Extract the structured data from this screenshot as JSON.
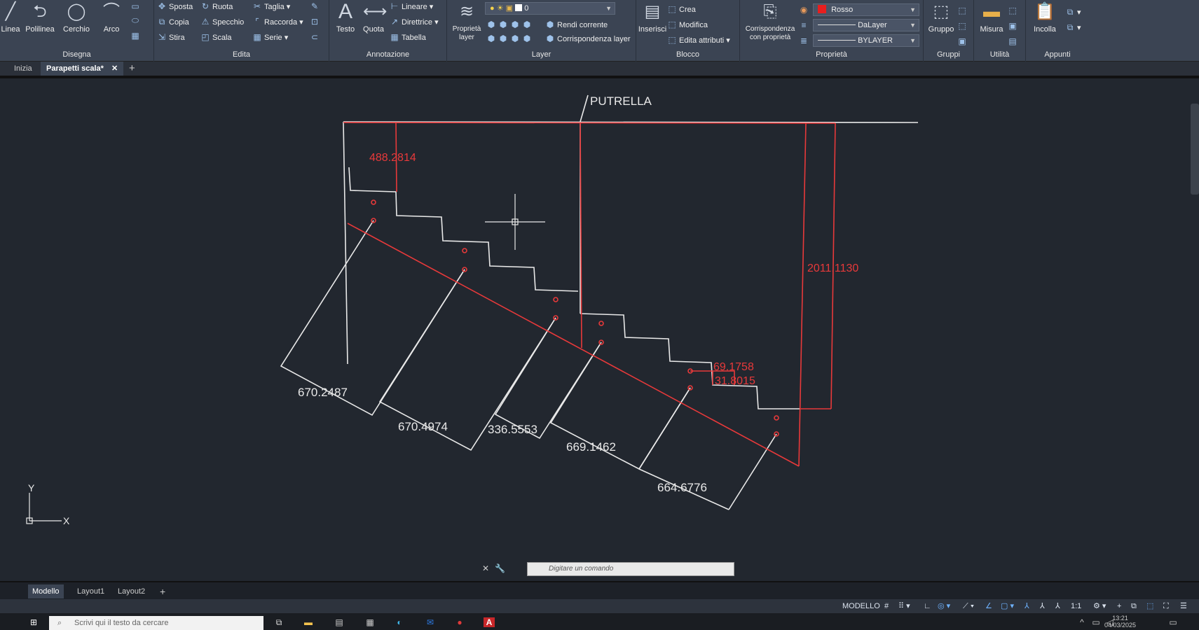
{
  "ribbon": {
    "disegna": {
      "title": "Disegna",
      "tools": [
        "Linea",
        "Polilinea",
        "Cerchio",
        "Arco"
      ]
    },
    "edita": {
      "title": "Edita",
      "tools": [
        "Sposta",
        "Ruota",
        "Taglia",
        "Copia",
        "Specchio",
        "Raccorda",
        "Stira",
        "Scala",
        "Serie"
      ]
    },
    "annotazione": {
      "title": "Annotazione",
      "tools": [
        "Testo",
        "Quota",
        "Lineare",
        "Direttrice",
        "Tabella"
      ]
    },
    "layer": {
      "title": "Layer",
      "proprieta_label": "Proprietà layer",
      "current_layer": "0",
      "tools": [
        "Rendi corrente",
        "Corrispondenza layer"
      ]
    },
    "blocco": {
      "title": "Blocco",
      "inserisci": "Inserisci",
      "tools": [
        "Crea",
        "Modifica",
        "Edita attributi"
      ]
    },
    "proprieta": {
      "title": "Proprietà",
      "match_label": "Corrispondenza con proprietà",
      "color": "Rosso",
      "color_hex": "#e81e1e",
      "linetype": "DaLayer",
      "lineweight": "BYLAYER"
    },
    "gruppi": {
      "title": "Gruppi",
      "tool": "Gruppo"
    },
    "utilita": {
      "title": "Utilità",
      "tool": "Misura"
    },
    "appunti": {
      "title": "Appunti",
      "tool": "Incolla"
    }
  },
  "filetabs": {
    "start": "Inizia",
    "active": "Parapetti scala*",
    "add": "+"
  },
  "drawing": {
    "label_putrella": "PUTRELLA",
    "red_dims": [
      "488.2814",
      "2011.1130",
      "69.1758",
      "31.8015"
    ],
    "white_dims": [
      "670.2487",
      "670.4974",
      "336.5553",
      "669.1462",
      "664.6776"
    ],
    "axis_x": "X",
    "axis_y": "Y"
  },
  "command": {
    "placeholder": "Digitare un comando"
  },
  "layouttabs": [
    "Modello",
    "Layout1",
    "Layout2",
    "+"
  ],
  "statusbar": {
    "mode": "MODELLO",
    "scale": "1:1"
  },
  "taskbar": {
    "search_placeholder": "Scrivi qui il testo da cercare",
    "time": "13:21",
    "date": "04/03/2025"
  }
}
